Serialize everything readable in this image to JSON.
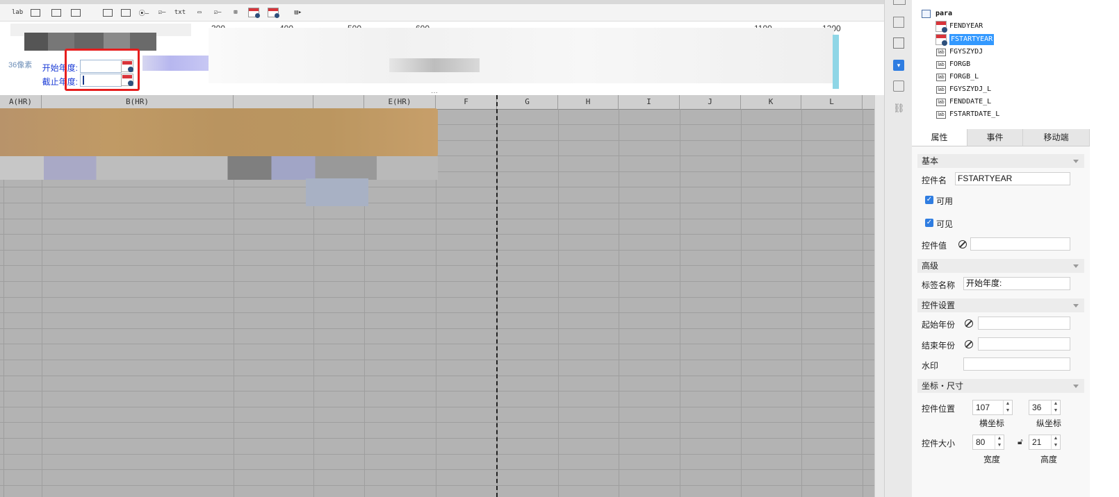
{
  "ruler": {
    "labels": [
      "300",
      "400",
      "500",
      "600",
      "1100",
      "1200"
    ]
  },
  "param_panel": {
    "px_label": "36像素",
    "start_label": "开始年度:",
    "end_label": "截止年度:"
  },
  "grid": {
    "columns": [
      "A(HR)",
      "B(HR)",
      "E(HR)",
      "F",
      "G",
      "H",
      "I",
      "J",
      "K",
      "L"
    ]
  },
  "tree": {
    "root": "para",
    "items": [
      "FENDYEAR",
      "FSTARTYEAR",
      "FGYSZYDJ",
      "FORGB",
      "FORGB_L",
      "FGYSZYDJ_L",
      "FENDDATE_L",
      "FSTARTDATE_L"
    ],
    "selected": "FSTARTYEAR"
  },
  "tabs": [
    "属性",
    "事件",
    "移动端"
  ],
  "props": {
    "basic_header": "基本",
    "name_label": "控件名",
    "name_value": "FSTARTYEAR",
    "enabled_label": "可用",
    "visible_label": "可见",
    "value_label": "控件值",
    "advanced_header": "高级",
    "tag_label": "标签名称",
    "tag_value": "开始年度:",
    "settings_header": "控件设置",
    "start_year_label": "起始年份",
    "end_year_label": "结束年份",
    "watermark_label": "水印",
    "coord_header": "坐标・尺寸",
    "position_label": "控件位置",
    "x_value": "107",
    "y_value": "36",
    "x_caption": "横坐标",
    "y_caption": "纵坐标",
    "size_label": "控件大小",
    "w_value": "80",
    "h_value": "21",
    "w_caption": "宽度",
    "h_caption": "高度"
  },
  "colors": {
    "selection_border": "#e61e1e",
    "label_blue": "#1a3bd6",
    "checkbox_blue": "#2f7de1",
    "tree_selected": "#3399ff",
    "grid_bg": "#b3b3b3"
  }
}
